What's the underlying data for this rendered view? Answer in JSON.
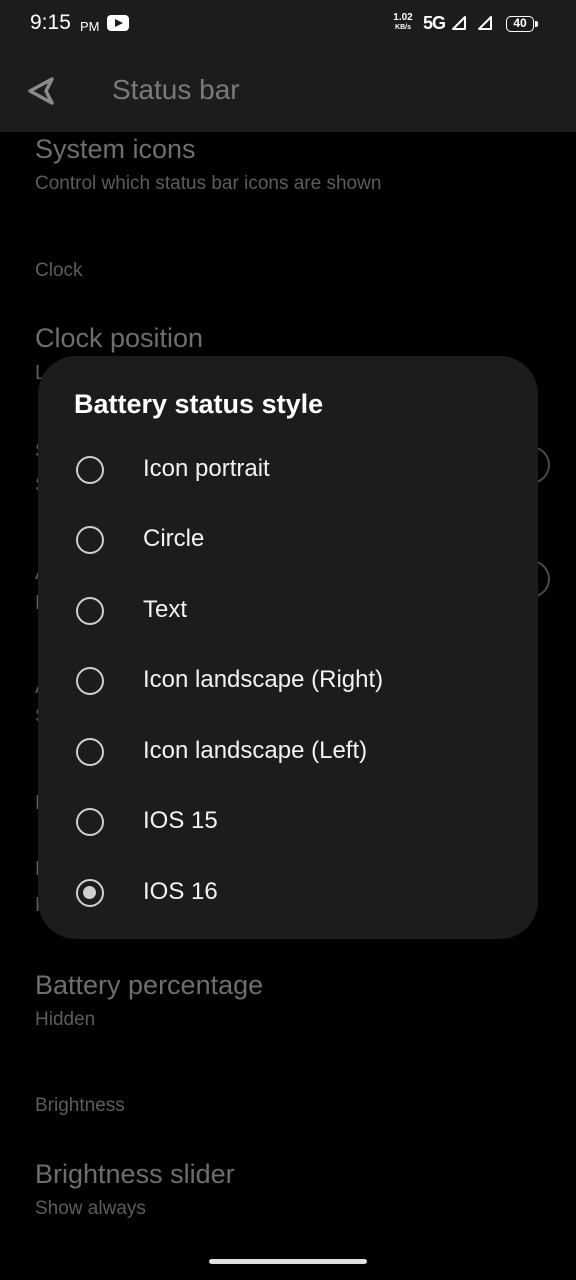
{
  "status_bar": {
    "time": "9:15",
    "ampm": "PM",
    "net_speed": "1.02",
    "net_unit": "KB/s",
    "network": "5G",
    "battery": "40"
  },
  "app_bar": {
    "title": "Status bar"
  },
  "settings": {
    "system_icons_title": "System icons",
    "system_icons_sub": "Control which status bar icons are shown",
    "clock_header": "Clock",
    "clock_position_title": "Clock position",
    "clock_position_sub_partial": "L",
    "partial_1": "S",
    "partial_2": "S",
    "partial_3": "A",
    "partial_4": "D",
    "partial_5": "A",
    "partial_6": "S",
    "partial_7": "B",
    "partial_8": "B",
    "partial_9": "H",
    "battery_percentage_title": "Battery percentage",
    "battery_percentage_sub": "Hidden",
    "brightness_header": "Brightness",
    "brightness_slider_title": "Brightness slider",
    "brightness_slider_sub": "Show always"
  },
  "dialog": {
    "title": "Battery status style",
    "options": [
      {
        "label": "Icon portrait",
        "selected": false
      },
      {
        "label": "Circle",
        "selected": false
      },
      {
        "label": "Text",
        "selected": false
      },
      {
        "label": "Icon landscape (Right)",
        "selected": false
      },
      {
        "label": "Icon landscape (Left)",
        "selected": false
      },
      {
        "label": "IOS 15",
        "selected": false
      },
      {
        "label": "IOS 16",
        "selected": true
      }
    ]
  }
}
